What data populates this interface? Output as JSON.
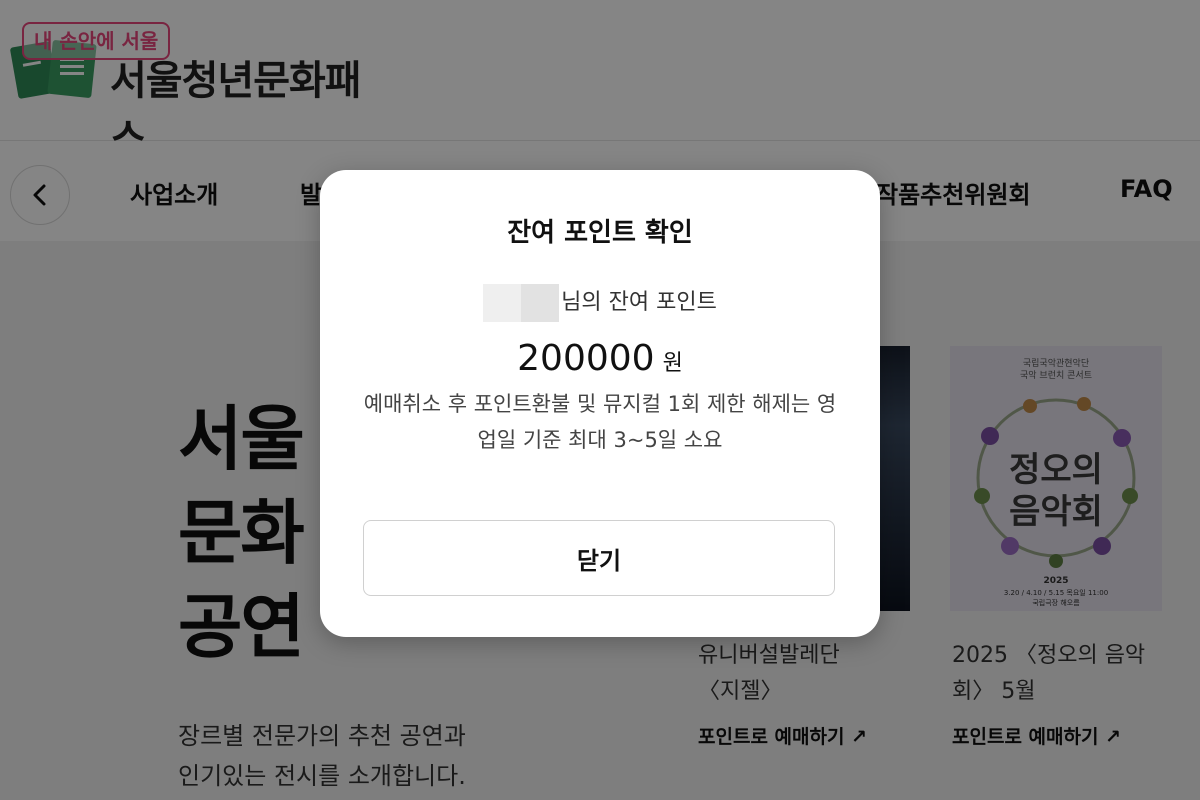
{
  "logo": {
    "badge": "내 손안에 서울",
    "text": "서울청년문화패스"
  },
  "nav": {
    "items": [
      "사업소개",
      "발",
      "작품추천위원회",
      "FAQ"
    ]
  },
  "hero": {
    "title_lines": [
      "서울",
      "문화",
      "공연"
    ],
    "desc_lines": [
      "장르별 전문가의 추천 공연과",
      "인기있는 전시를 소개합니다."
    ]
  },
  "cards": [
    {
      "title_lines": [
        "유니버설발레단",
        "〈지젤〉"
      ],
      "link": "포인트로 예매하기 ↗"
    },
    {
      "title_lines": [
        "2025 〈정오의 음악",
        "회〉 5월"
      ],
      "link": "포인트로 예매하기 ↗",
      "poster": {
        "top": "국립국악관현악단",
        "top2": "국악 브런치 콘서트",
        "title1": "정오의",
        "title2": "음악회",
        "year": "2025",
        "dates": "3.20 / 4.10 / 5.15 목요일 11:00",
        "venue": "국립극장 해오름"
      }
    }
  ],
  "modal": {
    "title": "잔여 포인트 확인",
    "name_suffix": "님의 잔여 포인트",
    "points": "200000",
    "unit": "원",
    "notice": "예매취소 후 포인트환불 및 뮤지컬 1회 제한 해제는 영업일 기준 최대 3~5일 소요",
    "close": "닫기"
  },
  "colors": {
    "accent": "#e8477d",
    "logo_green": "#2e8b57"
  }
}
